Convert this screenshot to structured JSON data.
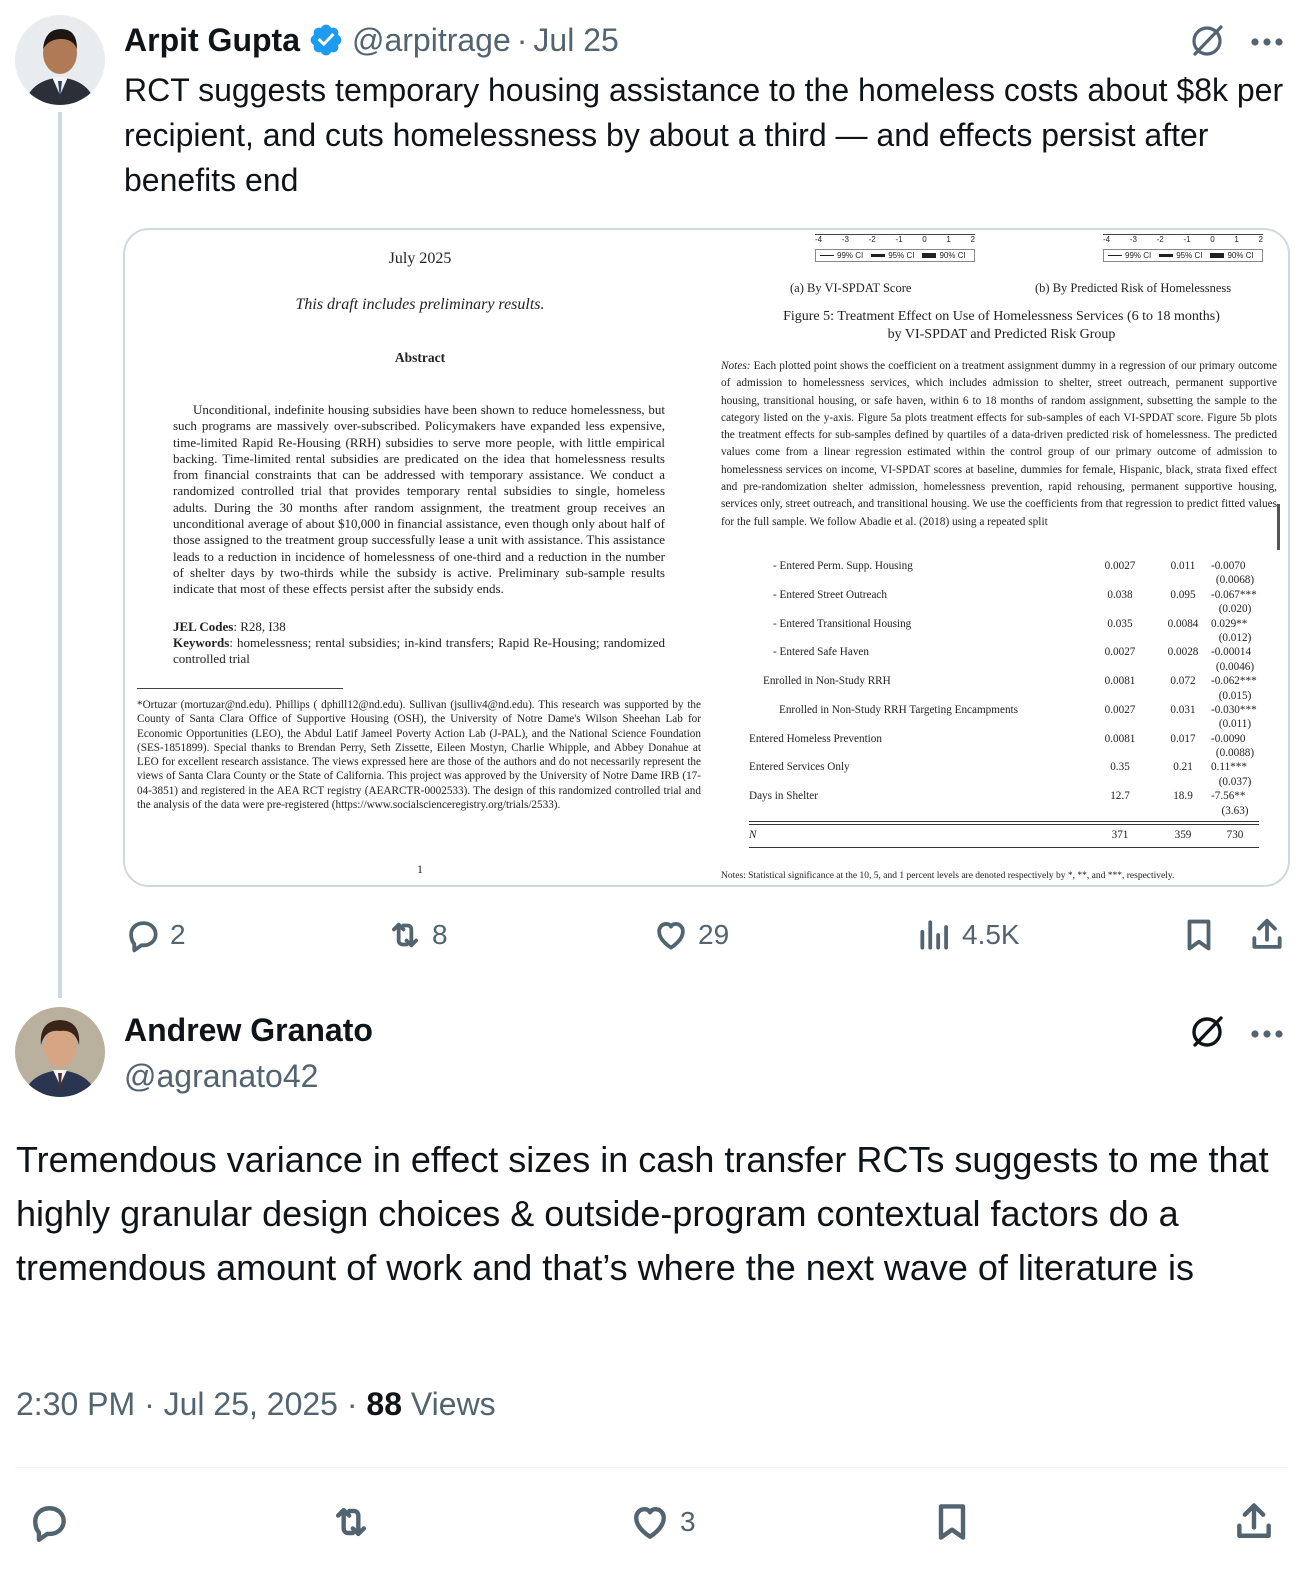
{
  "tweet1": {
    "author_name": "Arpit Gupta",
    "handle": "@arpitrage",
    "separator": "·",
    "date": "Jul 25",
    "text": "RCT suggests temporary housing assistance to the homeless costs about $8k per recipient, and cuts homelessness by about a third — and effects persist after benefits end",
    "verified_icon": "verified-badge-icon",
    "actions": {
      "reply": "2",
      "repost": "8",
      "like": "29",
      "views": "4.5K"
    }
  },
  "paper": {
    "date": "July 2025",
    "draft_note": "This draft includes preliminary results.",
    "abstract_title": "Abstract",
    "abstract": "Unconditional, indefinite housing subsidies have been shown to reduce homelessness, but such programs are massively over-subscribed. Policymakers have expanded less expensive, time-limited Rapid Re-Housing (RRH) subsidies to serve more people, with little empirical backing. Time-limited rental subsidies are predicated on the idea that homelessness results from financial constraints that can be addressed with temporary assistance. We conduct a randomized controlled trial that provides temporary rental subsidies to single, homeless adults. During the 30 months after random assignment, the treatment group receives an unconditional average of about $10,000 in financial assistance, even though only about half of those assigned to the treatment group successfully lease a unit with assistance. This assistance leads to a reduction in incidence of homelessness of one-third and a reduction in the number of shelter days by two-thirds while the subsidy is active. Preliminary sub-sample results indicate that most of these effects persist after the subsidy ends.",
    "jel_label": "JEL Codes",
    "jel": ": R28, I38",
    "keywords_label": "Keywords",
    "keywords": ": homelessness; rental subsidies; in-kind transfers; Rapid Re-Housing; randomized controlled trial",
    "footnote": "*Ortuzar (mortuzar@nd.edu). Phillips ( dphill12@nd.edu). Sullivan (jsulliv4@nd.edu). This research was supported by the County of Santa Clara Office of Supportive Housing (OSH), the University of Notre Dame's Wilson Sheehan Lab for Economic Opportunities (LEO), the Abdul Latif Jameel Poverty Action Lab (J-PAL), and the National Science Foundation (SES-1851899). Special thanks to Brendan Perry, Seth Zissette, Eileen Mostyn, Charlie Whipple, and Abbey Donahue at LEO for excellent research assistance. The views expressed here are those of the authors and do not necessarily represent the views of Santa Clara County or the State of California. This project was approved by the University of Notre Dame IRB (17-04-3851) and registered in the AEA RCT registry (AEARCTR-0002533). The design of this randomized controlled trial and the analysis of the data were pre-registered (https://www.socialscienceregistry.org/trials/2533).",
    "page_number": "1",
    "ticks": [
      "-4",
      "-3",
      "-2",
      "-1",
      "0",
      "1",
      "2"
    ],
    "legend": [
      "99% CI",
      "95% CI",
      "90% CI"
    ],
    "subfig_a": "(a) By VI-SPDAT Score",
    "subfig_b": "(b) By Predicted Risk of Homelessness",
    "figure_caption_1": "Figure 5: Treatment Effect on Use of Homelessness Services (6 to 18 months)",
    "figure_caption_2": "by VI-SPDAT and Predicted Risk Group",
    "notes_label": "Notes:",
    "notes": " Each plotted point shows the coefficient on a treatment assignment dummy in a regression of our primary outcome of admission to homelessness services, which includes admission to shelter, street outreach, permanent supportive housing, transitional housing, or safe haven, within 6 to 18 months of random assignment, subsetting the sample to the category listed on the y-axis. Figure 5a plots treatment effects for sub-samples of each VI-SPDAT score. Figure 5b plots the treatment effects for sub-samples defined by quartiles of a data-driven predicted risk of homelessness. The predicted values come from a linear regression estimated within the control group of our primary outcome of admission to homelessness services on income, VI-SPDAT scores at baseline, dummies for female, Hispanic, black, strata fixed effect and pre-randomization shelter admission, homelessness prevention, rapid rehousing, permanent supportive housing, services only, street outreach, and transitional housing. We use the coefficients from that regression to predict fitted values for the full sample. We follow Abadie et al. (2018) using a repeated split",
    "table_rows": [
      {
        "label": "- Entered Perm. Supp. Housing",
        "indent": 2,
        "c1": "0.0027",
        "c2": "0.011",
        "c3": "-0.0070",
        "se": "(0.0068)"
      },
      {
        "label": "- Entered Street Outreach",
        "indent": 2,
        "c1": "0.038",
        "c2": "0.095",
        "c3": "-0.067***",
        "se": "(0.020)"
      },
      {
        "label": "- Entered Transitional Housing",
        "indent": 2,
        "c1": "0.035",
        "c2": "0.0084",
        "c3": "0.029**",
        "se": "(0.012)"
      },
      {
        "label": "- Entered Safe Haven",
        "indent": 2,
        "c1": "0.0027",
        "c2": "0.0028",
        "c3": "-0.00014",
        "se": "(0.0046)"
      },
      {
        "label": "Enrolled in Non-Study RRH",
        "indent": 1,
        "c1": "0.0081",
        "c2": "0.072",
        "c3": "-0.062***",
        "se": "(0.015)"
      },
      {
        "label": "Enrolled in Non-Study RRH Targeting Encampments",
        "indent": 3,
        "c1": "0.0027",
        "c2": "0.031",
        "c3": "-0.030***",
        "se": "(0.011)"
      },
      {
        "label": "Entered Homeless Prevention",
        "indent": 0,
        "c1": "0.0081",
        "c2": "0.017",
        "c3": "-0.0090",
        "se": "(0.0088)"
      },
      {
        "label": "Entered Services Only",
        "indent": 0,
        "c1": "0.35",
        "c2": "0.21",
        "c3": "0.11***",
        "se": "(0.037)"
      },
      {
        "label": "Days in Shelter",
        "indent": 0,
        "c1": "12.7",
        "c2": "18.9",
        "c3": "-7.56**",
        "se": "(3.63)"
      }
    ],
    "n_row": {
      "label": "N",
      "c1": "371",
      "c2": "359",
      "c3": "730"
    },
    "table_notes": "Notes: Statistical significance at the 10, 5, and 1 percent levels are denoted respectively by *, **, and ***, respectively."
  },
  "tweet2": {
    "author_name": "Andrew Granato",
    "handle": "@agranato42",
    "text": "Tremendous variance in effect sizes in cash transfer RCTs suggests to me that highly granular design choices & outside-program contextual factors do a tremendous amount of work and that’s where the next wave of literature is",
    "timestamp": "2:30 PM · Jul 25, 2025 · ",
    "views_count": "88",
    "views_label": " Views",
    "actions": {
      "like": "3"
    }
  },
  "icons": [
    "grok-icon",
    "more-icon",
    "reply-icon",
    "repost-icon",
    "like-icon",
    "views-icon",
    "bookmark-icon",
    "share-icon",
    "verified-badge-icon"
  ],
  "colors": {
    "text": "#0f1419",
    "muted": "#536471",
    "verified": "#1d9bf0",
    "border": "#cfd9de"
  }
}
